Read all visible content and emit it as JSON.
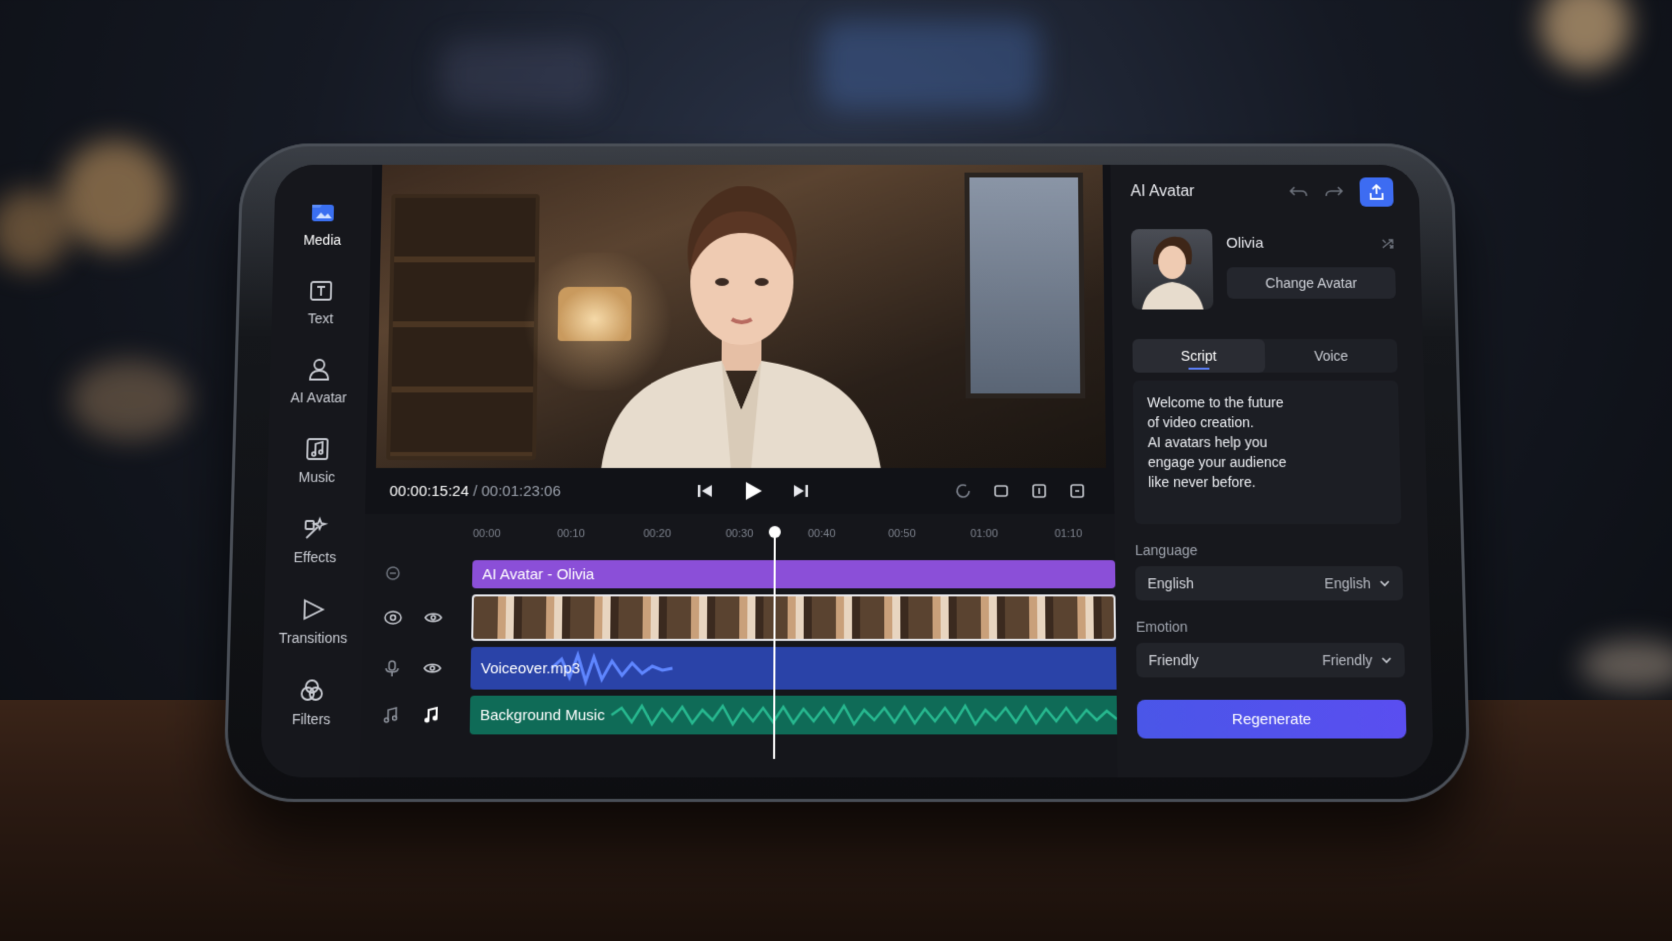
{
  "rail": {
    "items": [
      {
        "label": "Media",
        "icon": "media-folder-icon"
      },
      {
        "label": "Text",
        "icon": "text-icon"
      },
      {
        "label": "AI Avatar",
        "icon": "avatar-icon"
      },
      {
        "label": "Music",
        "icon": "music-icon"
      },
      {
        "label": "Effects",
        "icon": "effects-icon"
      },
      {
        "label": "Transitions",
        "icon": "transitions-icon"
      },
      {
        "label": "Filters",
        "icon": "filters-icon"
      }
    ]
  },
  "player": {
    "current_time": "00:00:15:24",
    "separator": " / ",
    "total_time": "00:01:23:06"
  },
  "timeline": {
    "ticks": [
      "00:00",
      "00:10",
      "00:20",
      "00:30",
      "00:40",
      "00:50",
      "01:00",
      "01:10"
    ],
    "tracks": {
      "avatar": "AI Avatar - Olivia",
      "voice": "Voiceover.mp3",
      "music": "Background Music"
    }
  },
  "panel": {
    "title": "AI Avatar",
    "avatar_name": "Olivia",
    "change_avatar": "Change Avatar",
    "tabs": [
      "Script",
      "Voice"
    ],
    "script_text": "Welcome to the future\nof video creation.\nAI avatars help you\nengage your audience\nlike never before.",
    "language_label": "Language",
    "language_value": "English",
    "language_value_right": "English",
    "emotion_label": "Emotion",
    "emotion_value": "Friendly",
    "emotion_value_right": "Friendly",
    "regenerate": "Regenerate"
  },
  "colors": {
    "accent_blue": "#3d6cf2",
    "avatar_track": "#8b4fd8",
    "voice_track": "#2a43a8",
    "music_track": "#0f6b57",
    "regenerate": "#4a56e8"
  }
}
